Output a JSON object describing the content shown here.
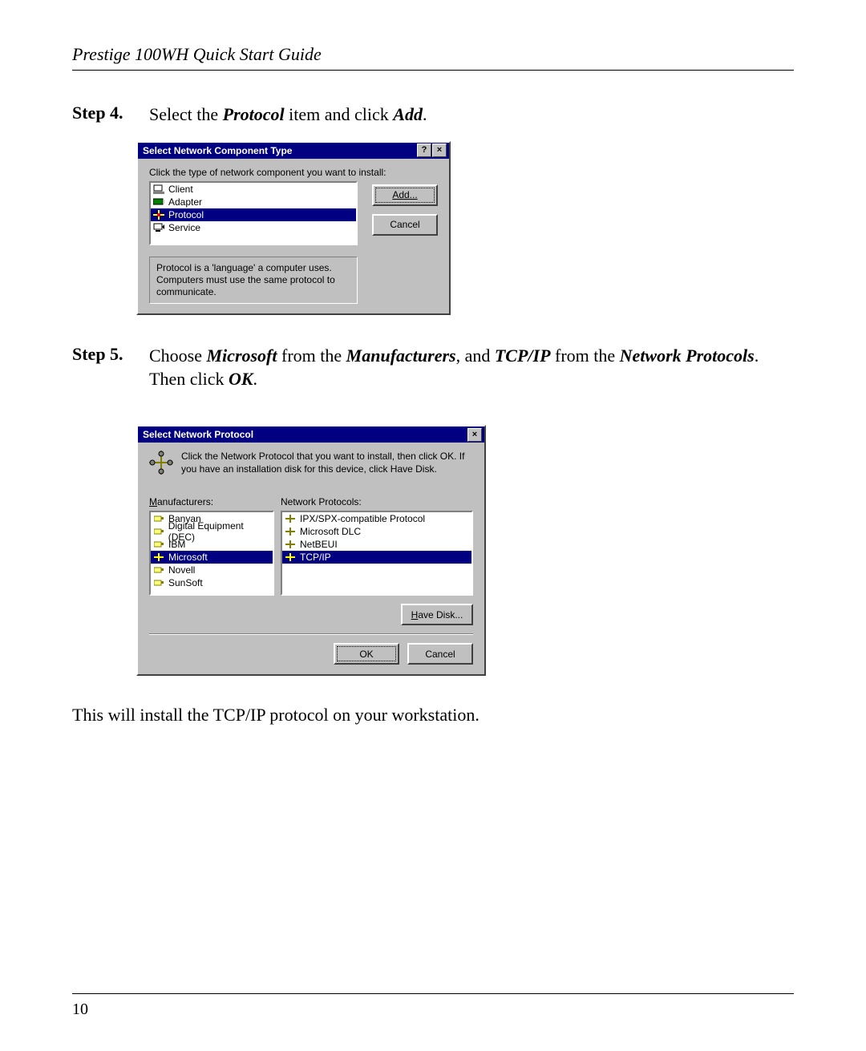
{
  "header_title": "Prestige 100WH Quick Start Guide",
  "step4": {
    "label": "Step 4.",
    "pre": "Select the ",
    "protocol": "Protocol",
    "mid": " item and click ",
    "add": "Add",
    "post": "."
  },
  "dialog1": {
    "title": "Select Network Component Type",
    "help_glyph": "?",
    "close_glyph": "×",
    "prompt": "Click the type of network component you want to install:",
    "items": [
      {
        "label": "Client",
        "icon": "client-icon",
        "selected": false
      },
      {
        "label": "Adapter",
        "icon": "adapter-icon",
        "selected": false
      },
      {
        "label": "Protocol",
        "icon": "protocol-icon",
        "selected": true
      },
      {
        "label": "Service",
        "icon": "service-icon",
        "selected": false
      }
    ],
    "add_label": "Add...",
    "cancel_label": "Cancel",
    "description": "Protocol is a 'language' a computer uses. Computers must use the same protocol to communicate."
  },
  "step5": {
    "label": "Step 5.",
    "t0": "Choose ",
    "microsoft": "Microsoft",
    "t1": " from the ",
    "manufacturers": "Manufacturers",
    "t2": ", and ",
    "tcpip": "TCP/IP",
    "t3": " from the ",
    "network_protocols": "Network Protocols",
    "t4": ". Then click ",
    "ok": "OK",
    "t5": "."
  },
  "dialog2": {
    "title": "Select Network Protocol",
    "close_glyph": "×",
    "instruction": "Click the Network Protocol that you want to install, then click OK. If you have an installation disk for this device, click Have Disk.",
    "manufacturers_label_pre": "M",
    "manufacturers_label_rest": "anufacturers:",
    "protocols_label": "Network Protocols:",
    "manufacturers": [
      {
        "label": "Banyan",
        "selected": false
      },
      {
        "label": "Digital Equipment (DEC)",
        "selected": false
      },
      {
        "label": "IBM",
        "selected": false
      },
      {
        "label": "Microsoft",
        "selected": true
      },
      {
        "label": "Novell",
        "selected": false
      },
      {
        "label": "SunSoft",
        "selected": false
      }
    ],
    "protocols": [
      {
        "label": "IPX/SPX-compatible Protocol",
        "selected": false
      },
      {
        "label": "Microsoft DLC",
        "selected": false
      },
      {
        "label": "NetBEUI",
        "selected": false
      },
      {
        "label": "TCP/IP",
        "selected": true
      }
    ],
    "have_disk_label_pre": "H",
    "have_disk_label_rest": "ave Disk...",
    "ok_label": "OK",
    "cancel_label": "Cancel"
  },
  "aftertext": "This will install the TCP/IP protocol on your workstation.",
  "page_number": "10"
}
